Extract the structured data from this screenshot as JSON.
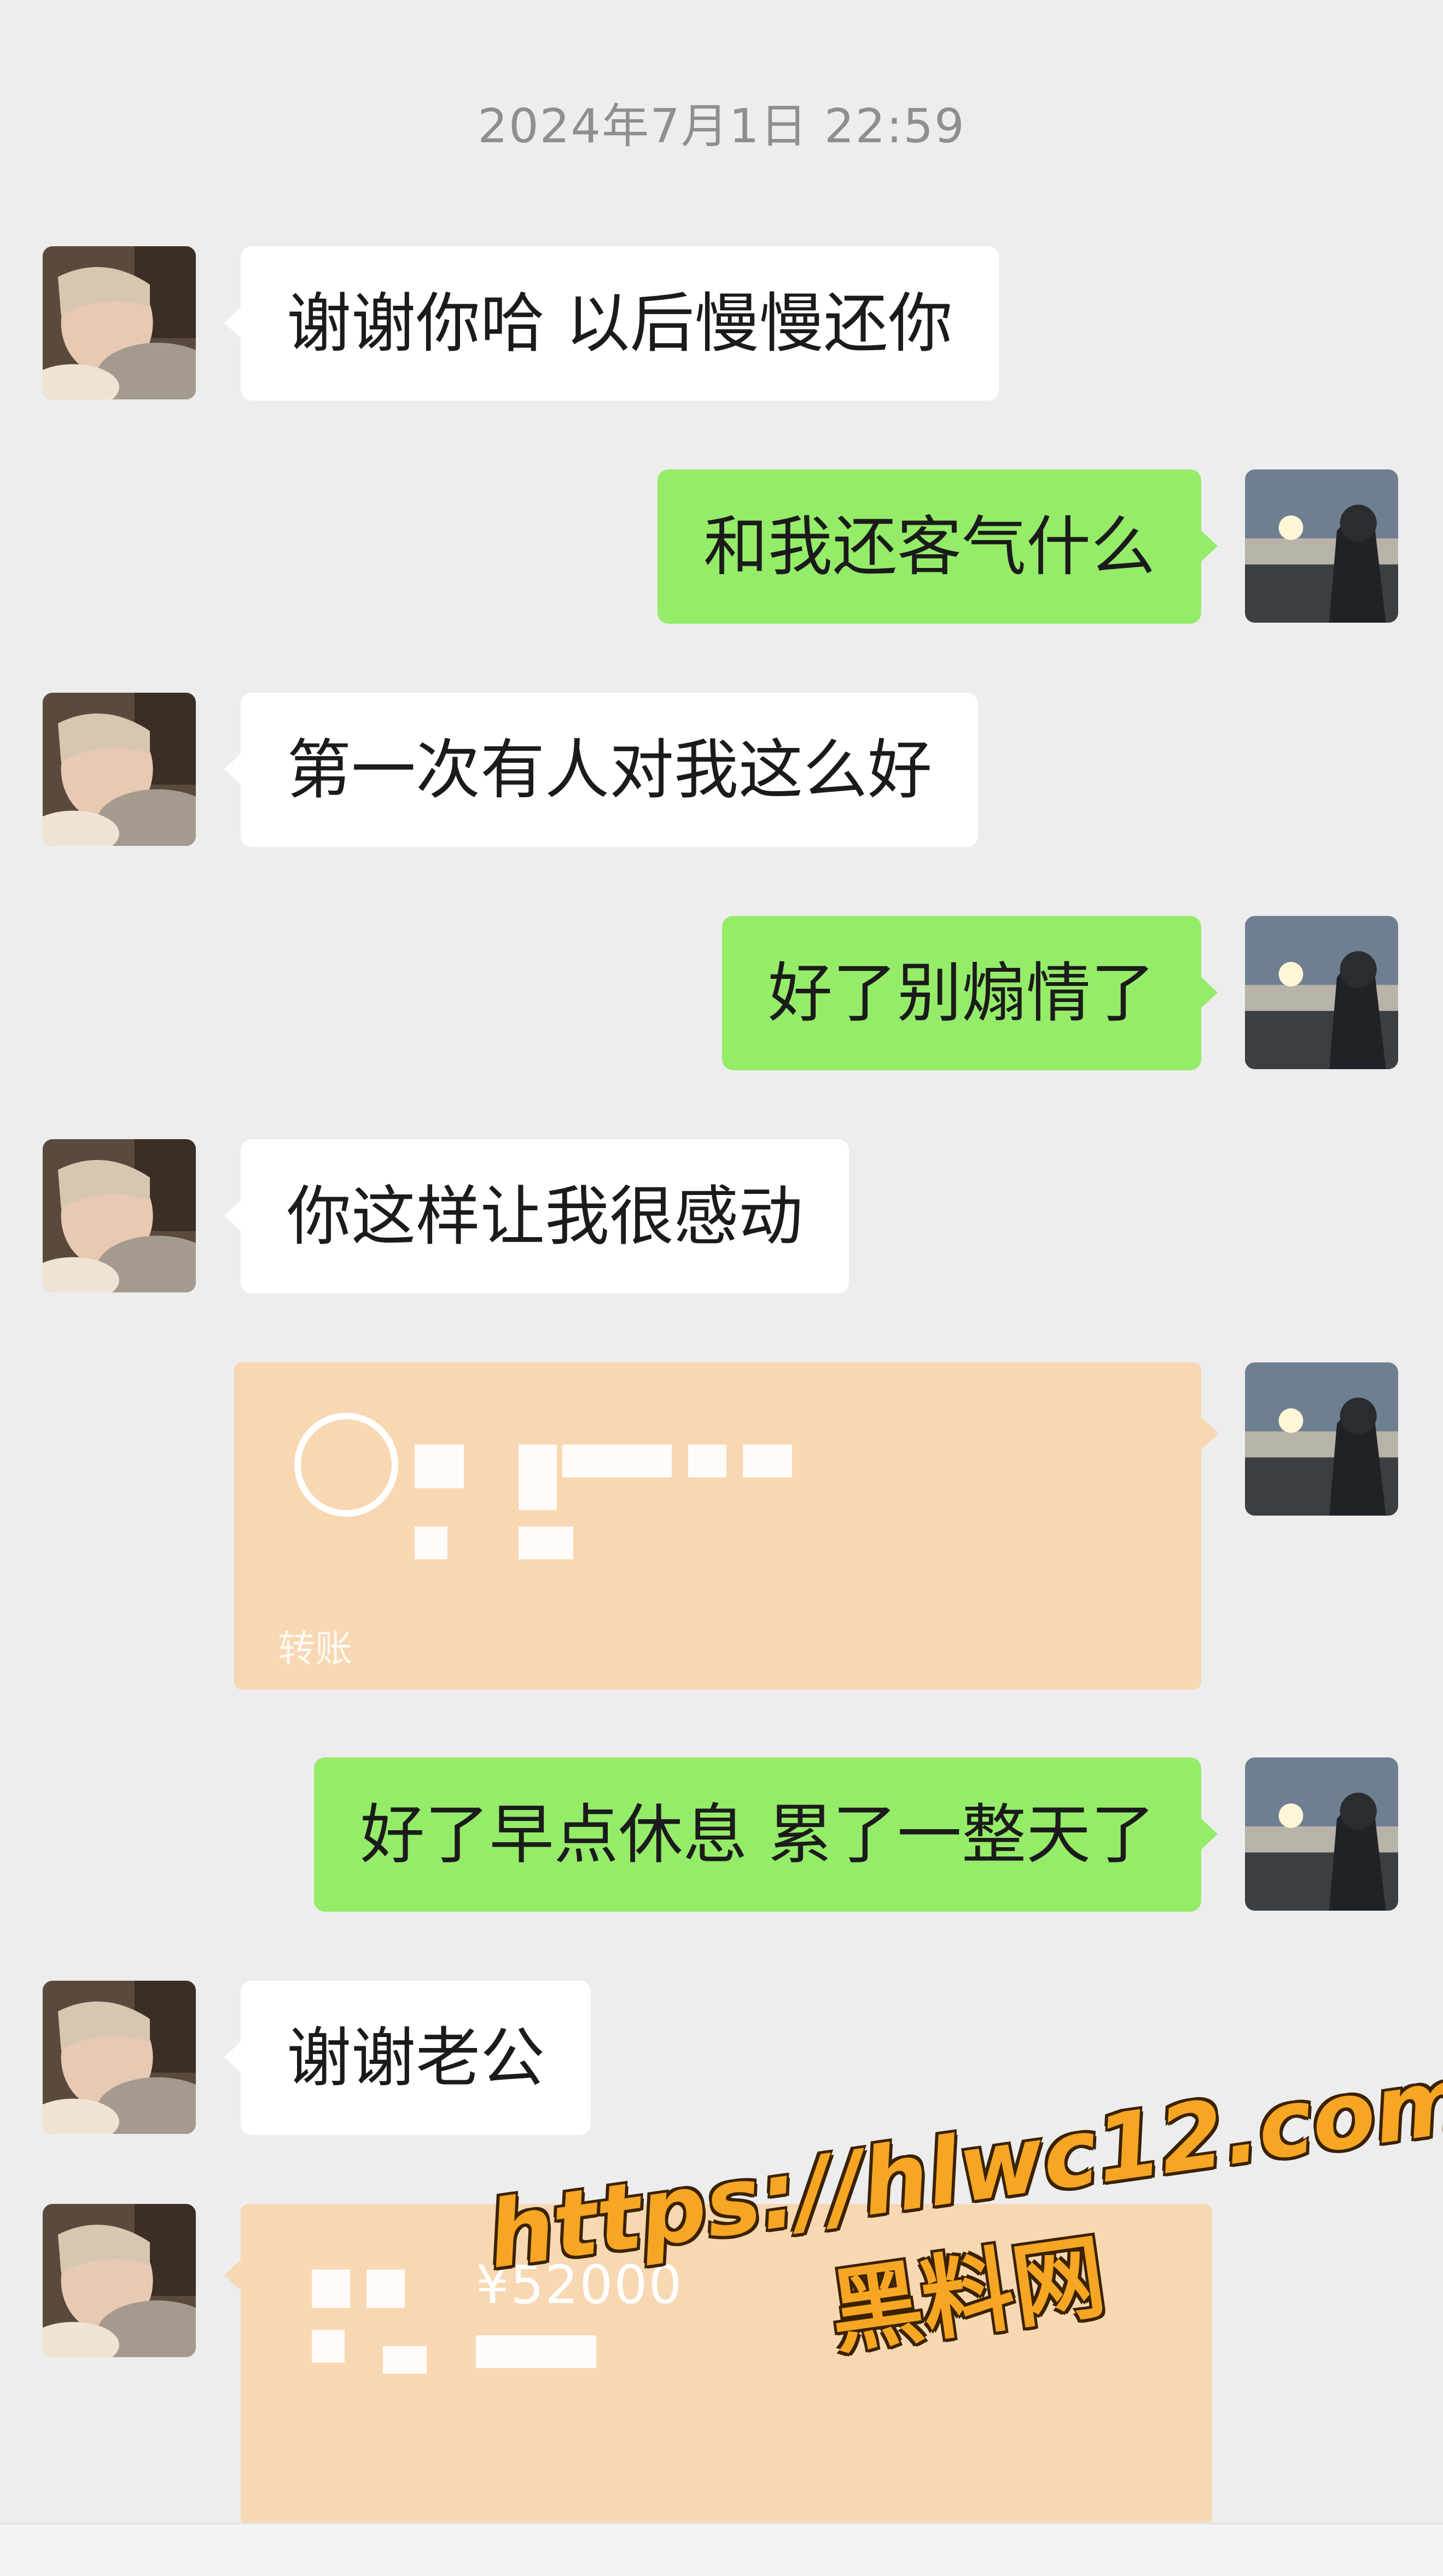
{
  "chat": {
    "timestamp": "2024年7月1日 22:59",
    "messages": [
      {
        "side": "in",
        "text": "谢谢你哈  以后慢慢还你"
      },
      {
        "side": "out",
        "text": "和我还客气什么"
      },
      {
        "side": "in",
        "text": "第一次有人对我这么好"
      },
      {
        "side": "out",
        "text": "好了别煽情了"
      },
      {
        "side": "in",
        "text": "你这样让我很感动"
      },
      {
        "side": "out",
        "type": "transfer",
        "label": "转账"
      },
      {
        "side": "out",
        "text": "好了早点休息  累了一整天了"
      },
      {
        "side": "in",
        "text": "谢谢老公"
      },
      {
        "side": "in",
        "type": "transfer",
        "amount": "¥52000"
      }
    ]
  },
  "watermark": {
    "url": "https://hlwc12.com",
    "site_name": "黑料网"
  },
  "colors": {
    "background": "#ededed",
    "bubble_in": "#ffffff",
    "bubble_out": "#95ec69",
    "transfer": "#f8d8b2",
    "watermark": "#f6a623"
  }
}
